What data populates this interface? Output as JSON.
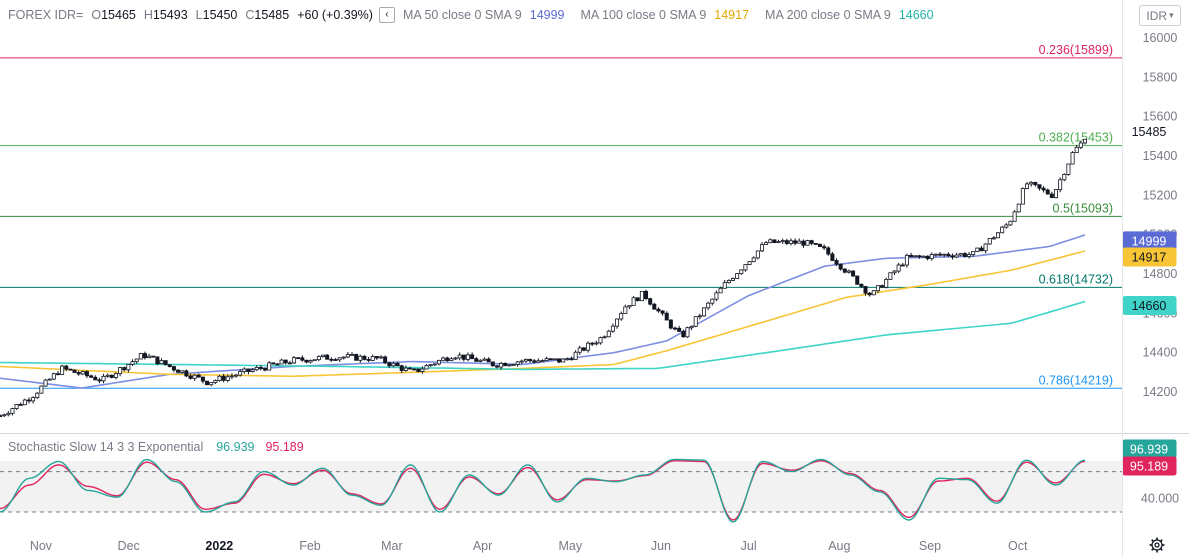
{
  "header": {
    "symbol": "FOREX IDR=",
    "open_label": "O",
    "open": "15465",
    "high_label": "H",
    "high": "15493",
    "low_label": "L",
    "low": "15450",
    "close_label": "C",
    "close": "15485",
    "change": "+60 (+0.39%)",
    "collapse_icon": "chevron-left-icon",
    "ma50_label": "MA 50 close 0 SMA 9",
    "ma50_value": "14999",
    "ma100_label": "MA 100 close 0 SMA 9",
    "ma100_value": "14917",
    "ma200_label": "MA 200 close 0 SMA 9",
    "ma200_value": "14660"
  },
  "currency_selector": {
    "value": "IDR",
    "icon": "chevron-down-icon"
  },
  "oscillator_header": {
    "label": "Stochastic Slow 14 3 3 Exponential",
    "k_value": "96.939",
    "d_value": "95.189"
  },
  "settings_icon": "gear-icon",
  "colors": {
    "up_candle": "#ffffff",
    "down_candle": "#131722",
    "ma50": "#7e8ee0",
    "ma100": "#f7c535",
    "ma200": "#3fd4c7",
    "stoch_k": "#26a69a",
    "stoch_d": "#e0245e",
    "fib_0236": "#e0245e",
    "fib_0382": "#4caf50",
    "fib_05": "#388e3c",
    "fib_0618": "#00796b",
    "fib_0786": "#2196f3"
  },
  "chart_data": [
    {
      "type": "candlestick",
      "title": "FOREX IDR=",
      "x_labels": [
        "Nov",
        "Dec",
        "2022",
        "Feb",
        "Mar",
        "Apr",
        "May",
        "Jun",
        "Jul",
        "Aug",
        "Sep",
        "Oct"
      ],
      "y_ticks": [
        14200,
        14400,
        14600,
        14800,
        15000,
        15200,
        15400,
        15600,
        15800,
        16000
      ],
      "ylim": [
        14060,
        16060
      ],
      "last_price": 15485,
      "grid": false,
      "approx_close_path": [
        {
          "date": "2021-10-18",
          "close": 14080
        },
        {
          "date": "2021-10-29",
          "close": 14180
        },
        {
          "date": "2021-11-08",
          "close": 14320
        },
        {
          "date": "2021-11-22",
          "close": 14260
        },
        {
          "date": "2021-12-06",
          "close": 14390
        },
        {
          "date": "2021-12-15",
          "close": 14330
        },
        {
          "date": "2021-12-28",
          "close": 14250
        },
        {
          "date": "2022-01-12",
          "close": 14310
        },
        {
          "date": "2022-01-26",
          "close": 14360
        },
        {
          "date": "2022-02-10",
          "close": 14380
        },
        {
          "date": "2022-02-24",
          "close": 14370
        },
        {
          "date": "2022-03-08",
          "close": 14300
        },
        {
          "date": "2022-03-22",
          "close": 14390
        },
        {
          "date": "2022-04-05",
          "close": 14340
        },
        {
          "date": "2022-04-15",
          "close": 14360
        },
        {
          "date": "2022-04-29",
          "close": 14360
        },
        {
          "date": "2022-05-12",
          "close": 14480
        },
        {
          "date": "2022-05-20",
          "close": 14640
        },
        {
          "date": "2022-05-26",
          "close": 14700
        },
        {
          "date": "2022-06-03",
          "close": 14560
        },
        {
          "date": "2022-06-08",
          "close": 14480
        },
        {
          "date": "2022-06-23",
          "close": 14750
        },
        {
          "date": "2022-07-07",
          "close": 14960
        },
        {
          "date": "2022-07-20",
          "close": 14960
        },
        {
          "date": "2022-07-27",
          "close": 14920
        },
        {
          "date": "2022-08-03",
          "close": 14820
        },
        {
          "date": "2022-08-12",
          "close": 14690
        },
        {
          "date": "2022-08-24",
          "close": 14880
        },
        {
          "date": "2022-09-07",
          "close": 14900
        },
        {
          "date": "2022-09-16",
          "close": 14900
        },
        {
          "date": "2022-09-28",
          "close": 15060
        },
        {
          "date": "2022-10-04",
          "close": 15260
        },
        {
          "date": "2022-10-13",
          "close": 15200
        },
        {
          "date": "2022-10-20",
          "close": 15420
        },
        {
          "date": "2022-10-24",
          "close": 15485
        }
      ],
      "series": [
        {
          "name": "MA 50 close 0 SMA 9",
          "last": 14999,
          "approx_path": [
            {
              "date": "2021-10-18",
              "value": 14270
            },
            {
              "date": "2021-11-15",
              "value": 14220
            },
            {
              "date": "2021-12-15",
              "value": 14290
            },
            {
              "date": "2022-01-26",
              "value": 14330
            },
            {
              "date": "2022-03-08",
              "value": 14355
            },
            {
              "date": "2022-04-15",
              "value": 14340
            },
            {
              "date": "2022-05-16",
              "value": 14400
            },
            {
              "date": "2022-06-03",
              "value": 14460
            },
            {
              "date": "2022-07-01",
              "value": 14690
            },
            {
              "date": "2022-07-27",
              "value": 14840
            },
            {
              "date": "2022-08-17",
              "value": 14880
            },
            {
              "date": "2022-09-16",
              "value": 14890
            },
            {
              "date": "2022-10-12",
              "value": 14940
            },
            {
              "date": "2022-10-24",
              "value": 14999
            }
          ]
        },
        {
          "name": "MA 100 close 0 SMA 9",
          "last": 14917,
          "approx_path": [
            {
              "date": "2021-10-18",
              "value": 14330
            },
            {
              "date": "2021-11-15",
              "value": 14310
            },
            {
              "date": "2021-12-15",
              "value": 14290
            },
            {
              "date": "2022-01-26",
              "value": 14280
            },
            {
              "date": "2022-03-08",
              "value": 14300
            },
            {
              "date": "2022-04-15",
              "value": 14320
            },
            {
              "date": "2022-05-16",
              "value": 14340
            },
            {
              "date": "2022-06-03",
              "value": 14410
            },
            {
              "date": "2022-07-07",
              "value": 14560
            },
            {
              "date": "2022-08-03",
              "value": 14680
            },
            {
              "date": "2022-09-02",
              "value": 14750
            },
            {
              "date": "2022-09-29",
              "value": 14820
            },
            {
              "date": "2022-10-24",
              "value": 14917
            }
          ]
        },
        {
          "name": "MA 200 close 0 SMA 9",
          "last": 14660,
          "approx_path": [
            {
              "date": "2021-10-18",
              "value": 14350
            },
            {
              "date": "2021-12-15",
              "value": 14340
            },
            {
              "date": "2022-02-10",
              "value": 14330
            },
            {
              "date": "2022-04-15",
              "value": 14315
            },
            {
              "date": "2022-05-31",
              "value": 14320
            },
            {
              "date": "2022-07-07",
              "value": 14400
            },
            {
              "date": "2022-08-17",
              "value": 14490
            },
            {
              "date": "2022-09-29",
              "value": 14550
            },
            {
              "date": "2022-10-24",
              "value": 14660
            }
          ]
        }
      ],
      "fibonacci": [
        {
          "ratio": "0.236",
          "price": 15899,
          "label": "0.236(15899)"
        },
        {
          "ratio": "0.382",
          "price": 15453,
          "label": "0.382(15453)"
        },
        {
          "ratio": "0.5",
          "price": 15093,
          "label": "0.5(15093)"
        },
        {
          "ratio": "0.618",
          "price": 14732,
          "label": "0.618(14732)"
        },
        {
          "ratio": "0.786",
          "price": 14219,
          "label": "0.786(14219)"
        }
      ]
    },
    {
      "type": "line",
      "title": "Stochastic Slow 14 3 3 Exponential",
      "y_tick_labels": [
        "40.000"
      ],
      "upper_band": 80,
      "lower_band": 20,
      "series": [
        {
          "name": "%K",
          "last": 96.939,
          "approx_values": [
            20,
            70,
            95,
            52,
            42,
            98,
            65,
            20,
            35,
            80,
            60,
            85,
            45,
            30,
            90,
            20,
            75,
            45,
            90,
            35,
            70,
            65,
            75,
            98,
            97,
            5,
            95,
            80,
            98,
            75,
            50,
            8,
            70,
            68,
            33,
            97,
            60,
            96.939
          ]
        },
        {
          "name": "%D",
          "last": 95.189,
          "approx_values": [
            25,
            60,
            90,
            58,
            44,
            94,
            68,
            24,
            33,
            76,
            62,
            82,
            47,
            32,
            85,
            24,
            72,
            47,
            86,
            38,
            68,
            66,
            74,
            96,
            95,
            8,
            92,
            82,
            96,
            77,
            52,
            12,
            66,
            70,
            36,
            94,
            63,
            95.189
          ]
        }
      ]
    }
  ]
}
